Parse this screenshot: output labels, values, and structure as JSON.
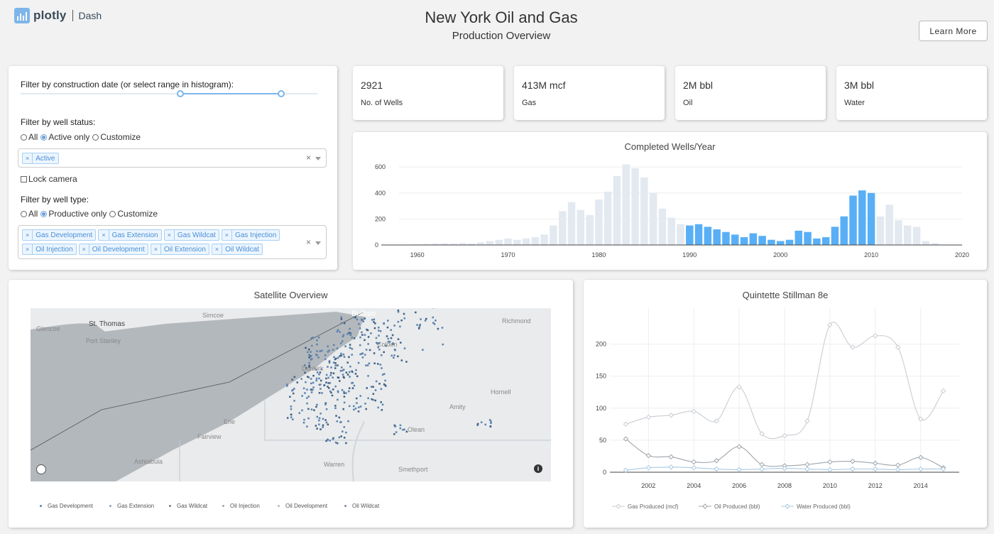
{
  "header": {
    "logo_text": "plotly",
    "logo_sub": "Dash",
    "title": "New York Oil and Gas",
    "subtitle": "Production Overview",
    "learn_more": "Learn More"
  },
  "filters": {
    "date_label": "Filter by construction date (or select range in histogram):",
    "slider": {
      "min": 1960,
      "max": 2017,
      "selected": [
        1990,
        2010
      ]
    },
    "status_label": "Filter by well status:",
    "status_options": [
      "All",
      "Active only",
      "Customize"
    ],
    "status_selected": "Active only",
    "status_tags": [
      "Active"
    ],
    "lock_camera": "Lock camera",
    "type_label": "Filter by well type:",
    "type_options": [
      "All",
      "Productive only",
      "Customize"
    ],
    "type_selected": "Productive only",
    "type_tags": [
      "Gas Development",
      "Gas Extension",
      "Gas Wildcat",
      "Gas Injection",
      "Oil Injection",
      "Oil Development",
      "Oil Extension",
      "Oil Wildcat"
    ],
    "clear_glyph": "×"
  },
  "stats": [
    {
      "value": "2921",
      "label": "No. of Wells"
    },
    {
      "value": "413M mcf",
      "label": "Gas"
    },
    {
      "value": "2M bbl",
      "label": "Oil"
    },
    {
      "value": "3M bbl",
      "label": "Water"
    }
  ],
  "chart_data": [
    {
      "type": "bar",
      "title": "Completed Wells/Year",
      "x": [
        1960,
        1961,
        1962,
        1963,
        1964,
        1965,
        1966,
        1967,
        1968,
        1969,
        1970,
        1971,
        1972,
        1973,
        1974,
        1975,
        1976,
        1977,
        1978,
        1979,
        1980,
        1981,
        1982,
        1983,
        1984,
        1985,
        1986,
        1987,
        1988,
        1989,
        1990,
        1991,
        1992,
        1993,
        1994,
        1995,
        1996,
        1997,
        1998,
        1999,
        2000,
        2001,
        2002,
        2003,
        2004,
        2005,
        2006,
        2007,
        2008,
        2009,
        2010,
        2011,
        2012,
        2013,
        2014,
        2015,
        2016,
        2017
      ],
      "values": [
        5,
        8,
        10,
        12,
        10,
        15,
        12,
        20,
        30,
        40,
        50,
        40,
        50,
        60,
        80,
        150,
        260,
        330,
        270,
        230,
        350,
        410,
        530,
        620,
        590,
        520,
        400,
        280,
        210,
        160,
        150,
        160,
        140,
        120,
        100,
        80,
        60,
        90,
        70,
        40,
        30,
        40,
        110,
        100,
        50,
        60,
        140,
        220,
        380,
        420,
        400,
        220,
        310,
        190,
        150,
        140,
        30,
        15
      ],
      "highlight_range": [
        1990,
        2010
      ],
      "xlim": [
        1958,
        2020
      ],
      "ylim": [
        0,
        650
      ],
      "xticks": [
        1960,
        1970,
        1980,
        1990,
        2000,
        2010,
        2020
      ],
      "yticks": [
        0,
        200,
        400,
        600
      ],
      "colors": {
        "highlight": "#59aff5",
        "muted": "#e3e9f0"
      }
    },
    {
      "type": "line",
      "title": "Quintette Stillman 8e",
      "x": [
        2001,
        2002,
        2003,
        2004,
        2005,
        2006,
        2007,
        2008,
        2009,
        2010,
        2011,
        2012,
        2013,
        2014,
        2015
      ],
      "series": [
        {
          "name": "Gas Produced (mcf)",
          "values": [
            75,
            86,
            89,
            95,
            80,
            133,
            60,
            57,
            80,
            230,
            195,
            213,
            195,
            83,
            127
          ],
          "color": "#c8cdd2"
        },
        {
          "name": "Oil Produced (bbl)",
          "values": [
            52,
            26,
            24,
            16,
            18,
            40,
            12,
            10,
            12,
            16,
            17,
            14,
            11,
            23,
            7
          ],
          "color": "#9ea4aa"
        },
        {
          "name": "Water Produced (bbl)",
          "values": [
            3,
            7,
            8,
            7,
            5,
            4,
            5,
            6,
            5,
            4,
            5,
            5,
            4,
            5,
            5
          ],
          "color": "#a9c8df"
        }
      ],
      "xticks": [
        2002,
        2004,
        2006,
        2008,
        2010,
        2012,
        2014
      ],
      "yticks": [
        0,
        50,
        100,
        150,
        200
      ],
      "xlim": [
        2000.3,
        2015.7
      ],
      "ylim": [
        0,
        245
      ]
    }
  ],
  "map": {
    "title": "Satellite Overview",
    "places": [
      "Simcoe",
      "Buffalo",
      "St. Thomas",
      "Glencoe",
      "Port Stanley",
      "Richmond",
      "Colden",
      "Dunkirk",
      "Hornell",
      "Amity",
      "Olean",
      "Erie",
      "Fairview",
      "Warren",
      "Ashtabula",
      "Smethport"
    ],
    "legend": [
      "Gas Development",
      "Gas Extension",
      "Gas Wildcat",
      "Oil Injection",
      "Oil Development",
      "Oil Wildcat"
    ],
    "colors": {
      "water": "#b3b8bc",
      "land": "#e9ebed",
      "dots": "#5b82ad"
    }
  }
}
